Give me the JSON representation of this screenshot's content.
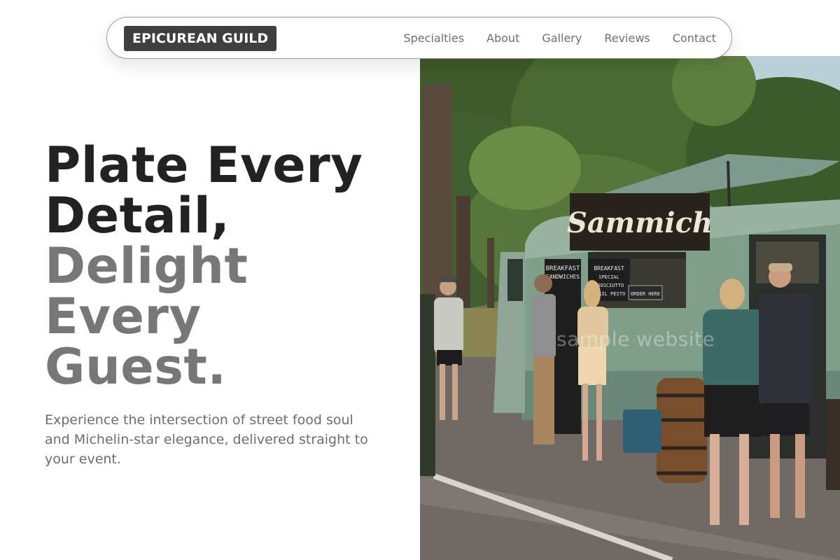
{
  "brand": {
    "name": "EPICUREAN GUILD"
  },
  "nav": {
    "links": [
      {
        "label": "Specialties"
      },
      {
        "label": "About"
      },
      {
        "label": "Gallery"
      },
      {
        "label": "Reviews"
      },
      {
        "label": "Contact"
      }
    ]
  },
  "hero": {
    "headline": {
      "line1": "Plate Every",
      "line2": "Detail,",
      "line3": "Delight",
      "line4": "Every",
      "line5": "Guest."
    },
    "subtext": "Experience the intersection of street food soul and Michelin-star elegance, delivered straight to your event.",
    "image": {
      "alt": "food-truck-photo",
      "truck_sign": "Sammich",
      "chalkboard_1": "BREAKFAST SANDWICHES",
      "chalkboard_2": "BREAKFAST SPECIAL PROSCIUTTO BASIL PESTO",
      "order_sign": "ORDER HERE",
      "watermark": "sample website"
    }
  },
  "colors": {
    "brand_bg": "#3f3f3f",
    "headline_dark": "#222222",
    "headline_light": "#777777",
    "nav_text": "#6f6f6f",
    "truck_green": "#7f9f8a"
  }
}
